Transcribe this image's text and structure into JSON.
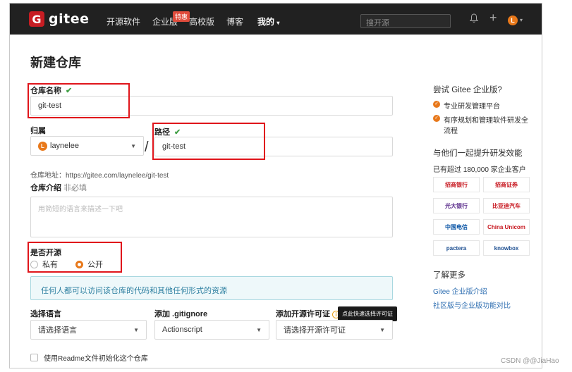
{
  "topbar": {
    "logo_letter": "G",
    "logo_text": "gitee",
    "nav": [
      "开源软件",
      "企业版",
      "高校版",
      "博客",
      "我的"
    ],
    "enterprise_badge": "特惠",
    "search_placeholder": "搜开源",
    "avatar_letter": "L"
  },
  "form": {
    "title": "新建仓库",
    "repo_name_label": "仓库名称",
    "repo_name_value": "git-test",
    "owner_label": "归属",
    "owner_value": "laynelee",
    "owner_avatar": "L",
    "path_label": "路径",
    "path_value": "git-test",
    "address": "仓库地址：https://gitee.com/laynelee/git-test",
    "intro_label": "仓库介绍",
    "intro_optional": "非必填",
    "intro_placeholder": "用简短的语言来描述一下吧",
    "open_source_label": "是否开源",
    "private_label": "私有",
    "public_label": "公开",
    "public_info": "任何人都可以访问该仓库的代码和其他任何形式的资源",
    "language_label": "选择语言",
    "language_value": "请选择语言",
    "gitignore_label": "添加 .gitignore",
    "gitignore_value": "Actionscript",
    "license_label": "添加开源许可证",
    "license_value": "请选择开源许可证",
    "license_tooltip": "点此快速选择许可证",
    "readme_label": "使用Readme文件初始化这个仓库"
  },
  "sidebar": {
    "try_title": "尝试 Gitee 企业版?",
    "bullet_1": "专业研发管理平台",
    "bullet_2": "有序规划和管理软件研发全流程",
    "together_title": "与他们一起提升研发效能",
    "count_text": "已有超过 180,000 家企业客户",
    "customers": [
      "招商银行",
      "招商证券",
      "光大银行",
      "比亚迪汽车",
      "中国电信",
      "China Unicom",
      "pactera",
      "knowbox"
    ],
    "learn_more": "了解更多",
    "link_1": "Gitee 企业版介绍",
    "link_2": "社区版与企业版功能对比"
  },
  "watermark": "CSDN @@JiaHao",
  "colors": {
    "brand": "#c71d23",
    "accent": "#e8781a",
    "annotation": "#e0151b"
  }
}
